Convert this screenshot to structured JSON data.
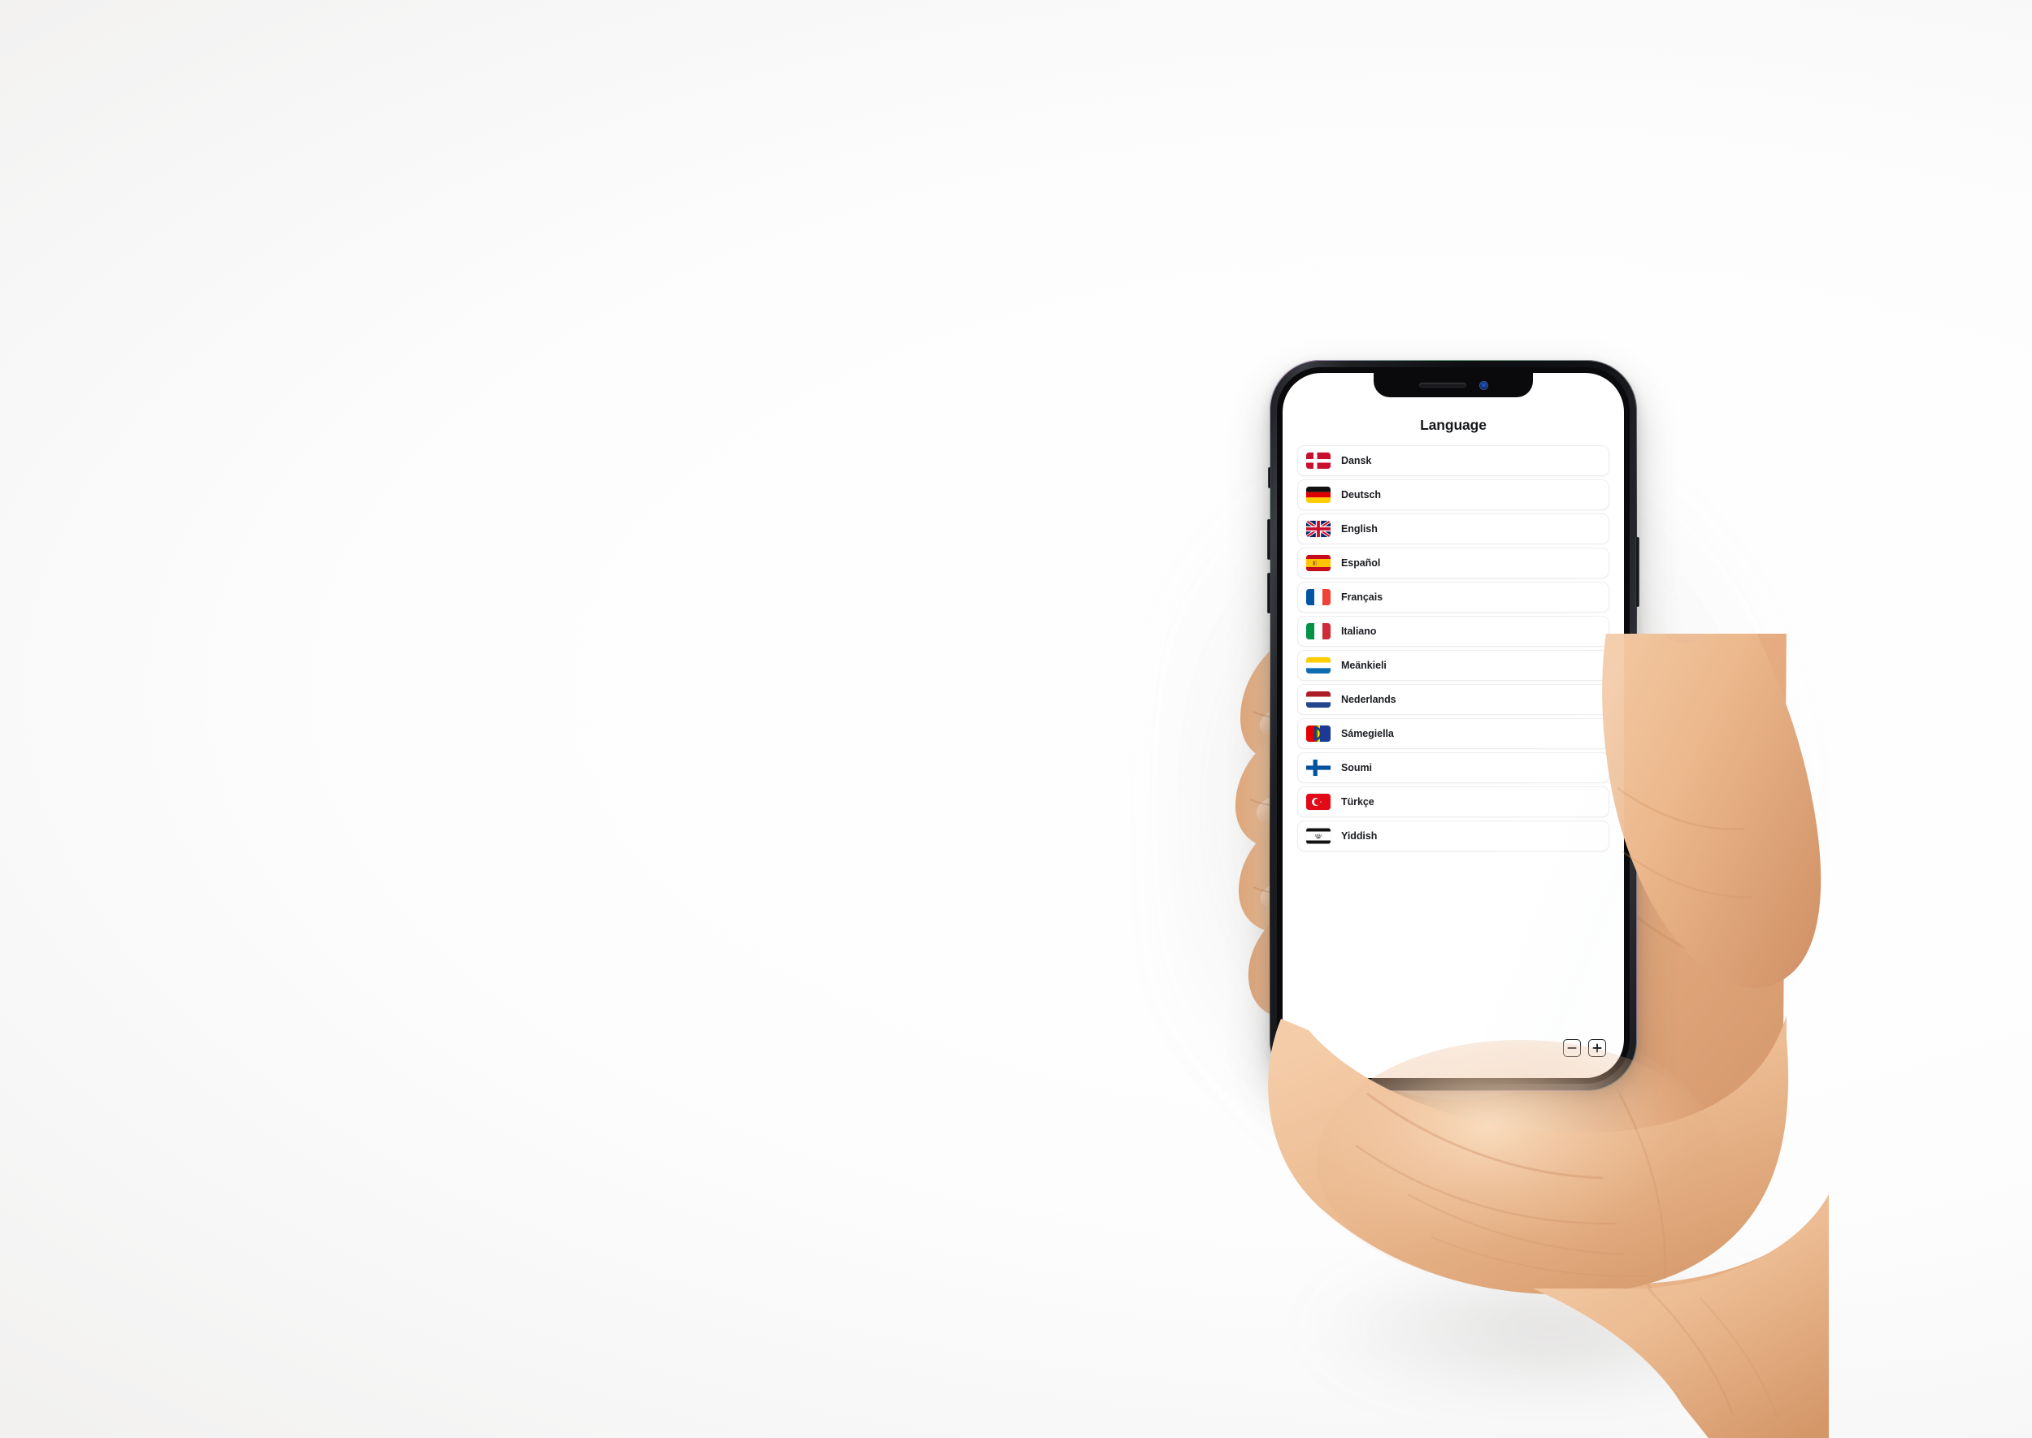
{
  "scene": {
    "background_color": "#ffffff",
    "description": "hand-holding-phone-mockup"
  },
  "device": {
    "name": "smartphone-mockup",
    "notch": {
      "earpiece": "earpiece-speaker",
      "camera": "front-camera"
    },
    "side_buttons": {
      "silent_switch": "silent-switch",
      "volume_up": "volume-up-button",
      "volume_down": "volume-down-button",
      "power": "power-button"
    }
  },
  "app": {
    "title": "Language",
    "languages": [
      {
        "label": "Dansk",
        "flag": "denmark-flag"
      },
      {
        "label": "Deutsch",
        "flag": "germany-flag"
      },
      {
        "label": "English",
        "flag": "united-kingdom-flag"
      },
      {
        "label": "Español",
        "flag": "spain-flag"
      },
      {
        "label": "Français",
        "flag": "france-flag"
      },
      {
        "label": "Italiano",
        "flag": "italy-flag"
      },
      {
        "label": "Meänkieli",
        "flag": "meankieli-flag"
      },
      {
        "label": "Nederlands",
        "flag": "netherlands-flag"
      },
      {
        "label": "Sámegiella",
        "flag": "sami-flag"
      },
      {
        "label": "Soumi",
        "flag": "finland-flag"
      },
      {
        "label": "Türkçe",
        "flag": "turkey-flag"
      },
      {
        "label": "Yiddish",
        "flag": "yiddish-flag"
      }
    ],
    "zoom_controls": {
      "zoom_out_label": "−",
      "zoom_in_label": "+"
    }
  },
  "colors": {
    "text": "#1a1c20",
    "card_bg": "#ffffff",
    "card_border": "#ececec",
    "denmark_red": "#c8102e",
    "germany_red": "#dd0000",
    "germany_gold": "#ffce00",
    "uk_blue": "#012169",
    "uk_red": "#c8102e",
    "spain_red": "#c60b1e",
    "spain_yellow": "#ffc400",
    "france_blue": "#0055a4",
    "france_red": "#ef4135",
    "italy_green": "#009246",
    "italy_red": "#ce2b37",
    "meankieli_yellow": "#ffcc00",
    "meankieli_blue": "#0e6db2",
    "netherlands_red": "#ae1c28",
    "netherlands_blue": "#21468b",
    "sami_red": "#e40000",
    "sami_blue": "#1a3a94",
    "sami_green": "#2a8000",
    "sami_yellow": "#ffcc00",
    "finland_blue": "#00529c",
    "turkey_red": "#e30a17",
    "yiddish_black": "#111111"
  }
}
